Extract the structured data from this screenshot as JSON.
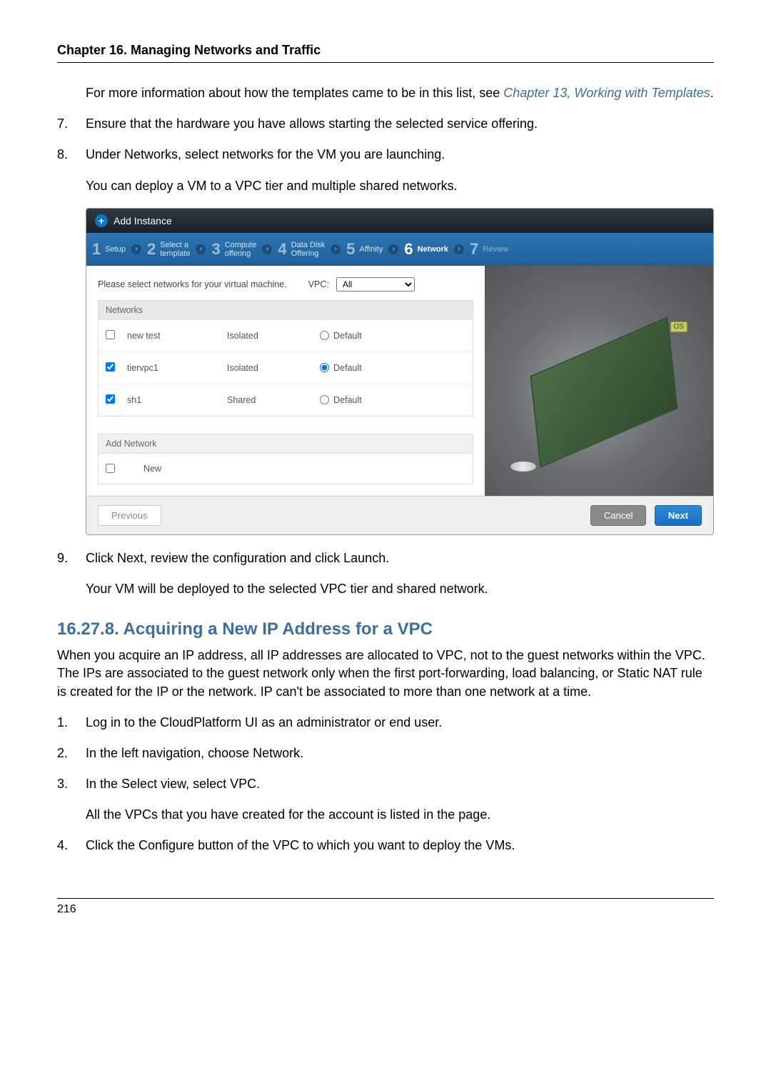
{
  "chapter_title": "Chapter 16. Managing Networks and Traffic",
  "intro_para_pre": "For more information about how the templates came to be in this list, see ",
  "intro_link": "Chapter 13, Working with Templates",
  "intro_para_post": ".",
  "list_top": [
    {
      "n": "7.",
      "text": "Ensure that the hardware you have allows starting the selected service offering."
    },
    {
      "n": "8.",
      "text": "Under Networks, select networks for the VM you are launching.",
      "sub": "You can deploy a VM to a VPC tier and multiple shared networks."
    }
  ],
  "shot": {
    "header": "Add Instance",
    "steps": [
      {
        "n": "1",
        "label": "Setup"
      },
      {
        "n": "2",
        "label": "Select a\ntemplate"
      },
      {
        "n": "3",
        "label": "Compute\noffering"
      },
      {
        "n": "4",
        "label": "Data Disk\nOffering"
      },
      {
        "n": "5",
        "label": "Affinity"
      },
      {
        "n": "6",
        "label": "Network"
      },
      {
        "n": "7",
        "label": "Review"
      }
    ],
    "active_step_index": 5,
    "instruction": "Please select networks for your virtual machine.",
    "vpc_label": "VPC:",
    "vpc_value": "All",
    "networks_header": "Networks",
    "rows": [
      {
        "checked": false,
        "name": "new test",
        "type": "Isolated",
        "default": false,
        "def_label": "Default"
      },
      {
        "checked": true,
        "name": "tiervpc1",
        "type": "Isolated",
        "default": true,
        "def_label": "Default"
      },
      {
        "checked": true,
        "name": "sh1",
        "type": "Shared",
        "default": false,
        "def_label": "Default"
      }
    ],
    "addnet_header": "Add Network",
    "addnet_label": "New",
    "illus_badge": "OS",
    "btn_prev": "Previous",
    "btn_cancel": "Cancel",
    "btn_next": "Next"
  },
  "list_mid": [
    {
      "n": "9.",
      "text": "Click Next, review the configuration and click Launch.",
      "sub": "Your VM will be deployed to the selected VPC tier and shared network."
    }
  ],
  "section_heading": "16.27.8. Acquiring a New IP Address for a VPC",
  "section_para": "When you acquire an IP address, all IP addresses are allocated to VPC, not to the guest networks within the VPC. The IPs are associated to the guest network only when the first port-forwarding, load balancing, or Static NAT rule is created for the IP or the network. IP can't be associated to more than one network at a time.",
  "list_bottom": [
    {
      "n": "1.",
      "text": "Log in to the CloudPlatform UI as an administrator or end user."
    },
    {
      "n": "2.",
      "text": "In the left navigation, choose Network."
    },
    {
      "n": "3.",
      "text": "In the Select view, select VPC.",
      "sub": "All the VPCs that you have created for the account is listed in the page."
    },
    {
      "n": "4.",
      "text": "Click the Configure button of the VPC to which you want to deploy the VMs."
    }
  ],
  "page_number": "216"
}
